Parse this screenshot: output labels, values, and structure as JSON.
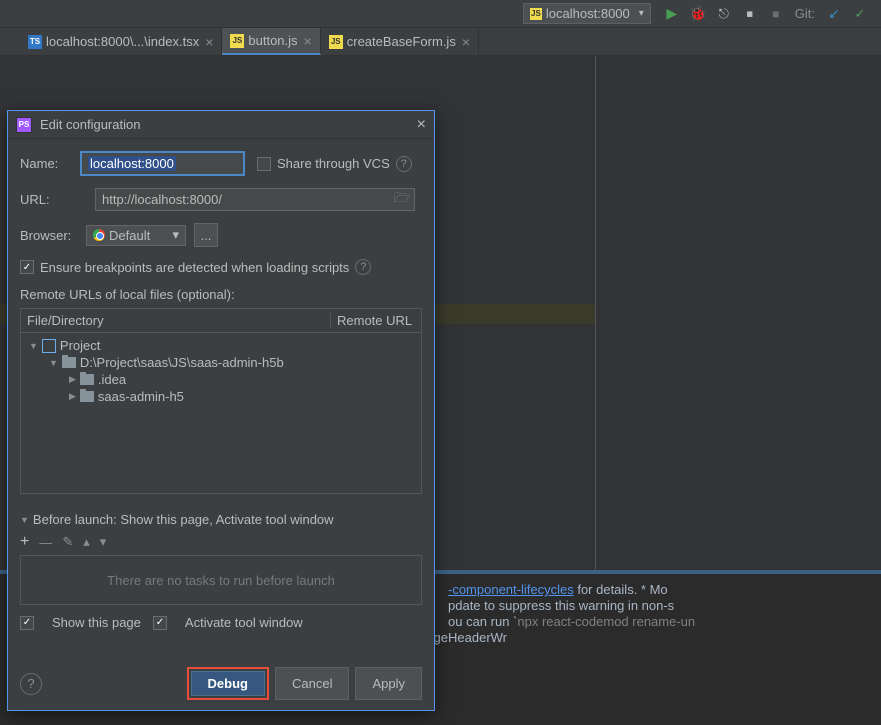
{
  "toolbar": {
    "run_config": "localhost:8000",
    "git_label": "Git:"
  },
  "tabs": [
    {
      "label": "localhost:8000\\...\\index.tsx",
      "icon": "tsx"
    },
    {
      "label": "button.js",
      "icon": "js"
    },
    {
      "label": "createBaseForm.js",
      "icon": "js"
    }
  ],
  "dialog": {
    "title": "Edit configuration",
    "name_label": "Name:",
    "name_value": "localhost:8000",
    "share_label": "Share through VCS",
    "url_label": "URL:",
    "url_value": "http://localhost:8000/",
    "browser_label": "Browser:",
    "browser_value": "Default",
    "ensure_label": "Ensure breakpoints are detected when loading scripts",
    "remote_urls_label": "Remote URLs of local files (optional):",
    "tree_header_1": "File/Directory",
    "tree_header_2": "Remote URL",
    "tree": {
      "project": "Project",
      "path": "D:\\Project\\saas\\JS\\saas-admin-h5b",
      "children": [
        ".idea",
        "saas-admin-h5"
      ]
    },
    "before_launch_label": "Before launch: Show this page, Activate tool window",
    "no_tasks": "There are no tasks to run before launch",
    "show_page": "Show this page",
    "activate_window": "Activate tool window",
    "buttons": {
      "debug": "Debug",
      "cancel": "Cancel",
      "apply": "Apply"
    }
  },
  "console": {
    "line1a": "-component-lifecycles",
    "line1b": " for details. * Mo",
    "line2": "pdate to suppress this warning in non-s",
    "line3a": "ou can run `",
    "line3b": "npx react-codemod rename-un",
    "line4": "omponents: Connect(Form(UserList)), Connect(GridContent), Connect(PageHeaderWr"
  }
}
